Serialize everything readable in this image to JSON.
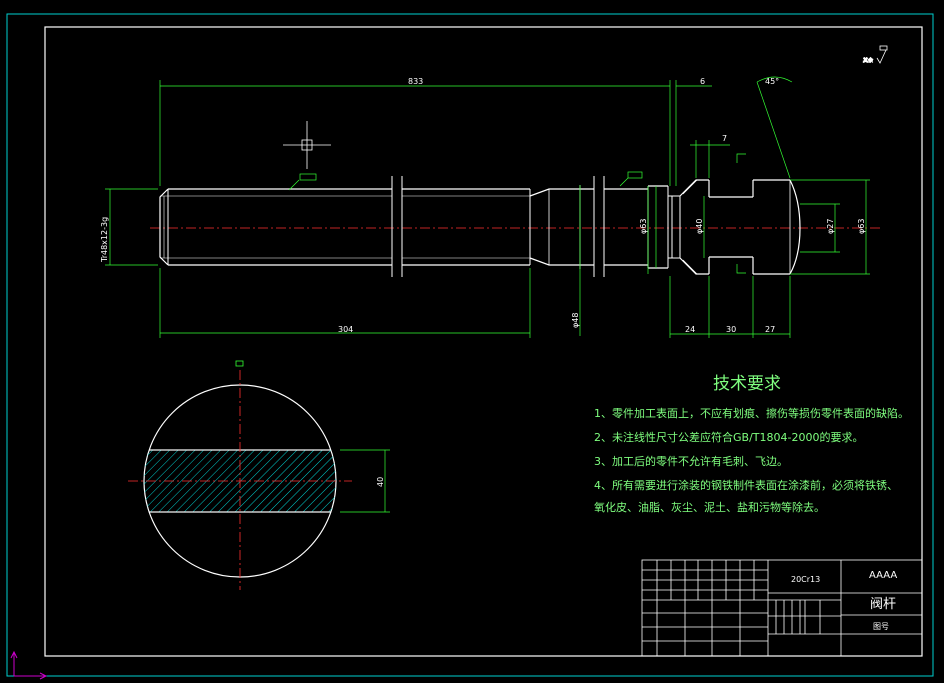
{
  "dimensions": {
    "overall_length": "833",
    "end_gap": "6",
    "thread_spec": "Tr48x12-3g",
    "chamfer_angle": "45°",
    "groove_width": "7",
    "thread_length": "304",
    "shank_diameter": "φ48",
    "diameter_left": "φ63",
    "diameter_groove": "φ40",
    "diameter_tip": "φ27",
    "diameter_right": "φ63",
    "seg1": "24",
    "seg2": "30",
    "seg3": "27",
    "section_height": "40"
  },
  "technical_requirements": {
    "title": "技术要求",
    "lines": [
      "1、零件加工表面上，不应有划痕、擦伤等损伤零件表面的缺陷。",
      "2、未注线性尺寸公差应符合GB/T1804-2000的要求。",
      "3、加工后的零件不允许有毛刺、飞边。",
      "4、所有需要进行涂装的钢铁制件表面在涂漆前，必须将铁锈、",
      "氧化皮、油脂、灰尘、泥土、盐和污物等除去。"
    ]
  },
  "title_block": {
    "material": "20Cr13",
    "company": "AAAA",
    "part_name": "阀杆",
    "drawing_no_label": "图号"
  },
  "colors": {
    "background": "#000000",
    "outer_frame": "#00cfcf",
    "outline": "#ffffff",
    "centerline": "#ff3030",
    "dimension": "#00ff00",
    "section_hatch": "#00cfcf",
    "text": "#7fff7f"
  }
}
